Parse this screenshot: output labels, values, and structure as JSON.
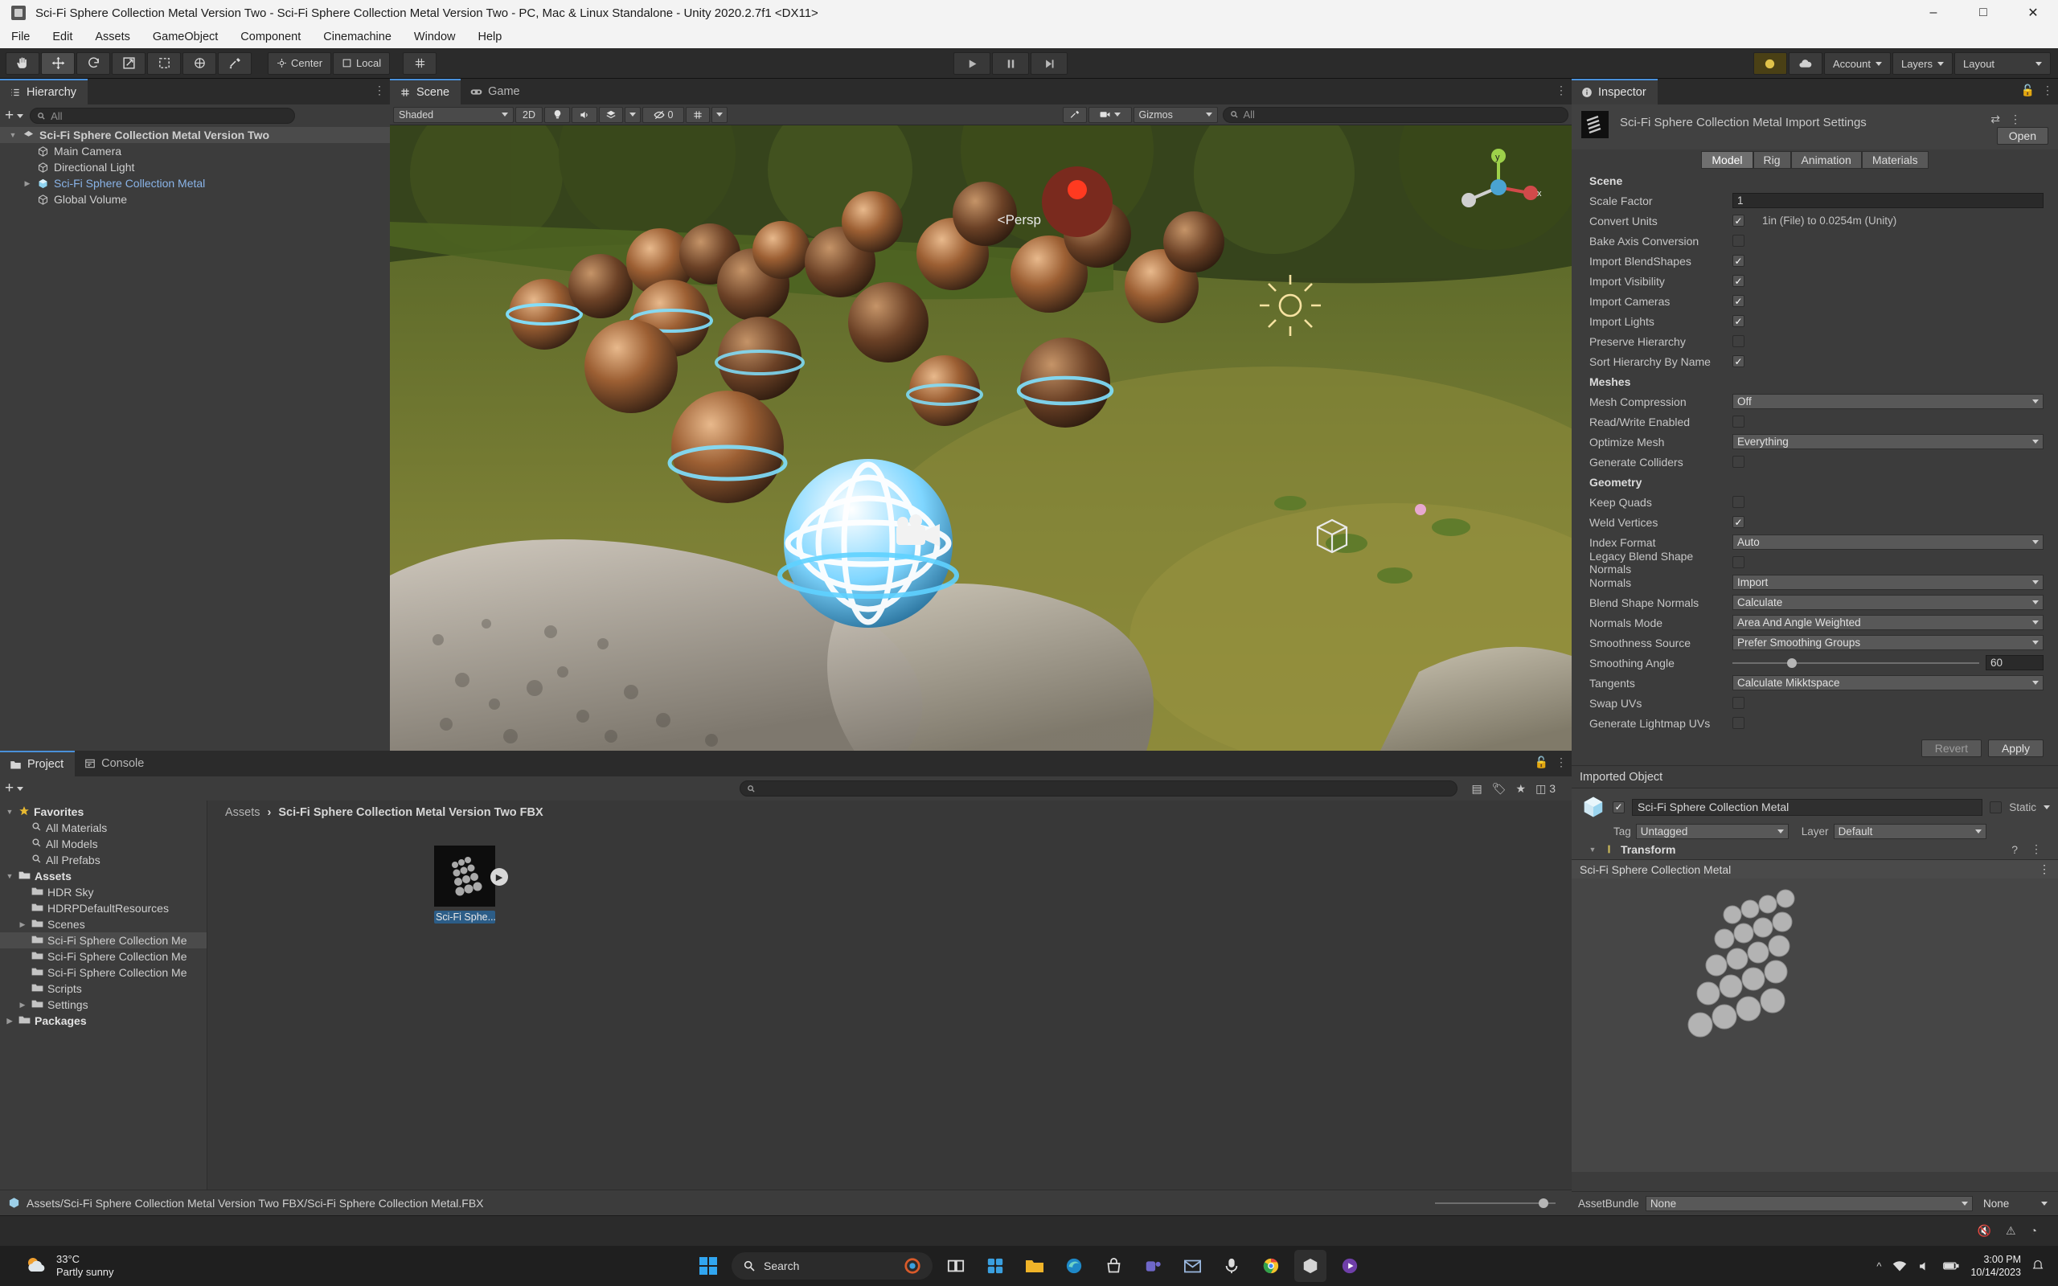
{
  "window": {
    "title": "Sci-Fi Sphere Collection Metal Version Two - Sci-Fi Sphere Collection Metal Version Two - PC, Mac & Linux Standalone - Unity 2020.2.7f1 <DX11>",
    "minimize": "–",
    "maximize": "□",
    "close": "✕"
  },
  "menubar": {
    "items": [
      "File",
      "Edit",
      "Assets",
      "GameObject",
      "Component",
      "Cinemachine",
      "Window",
      "Help"
    ]
  },
  "toolbar": {
    "tools": [
      "hand-tool",
      "move-tool",
      "rotate-tool",
      "scale-tool",
      "rect-tool",
      "transform-tool",
      "custom-tool"
    ],
    "pivot_label": "Center",
    "space_label": "Local",
    "play": "▶",
    "pause": "❙❙",
    "step": "▶|",
    "account_label": "Account",
    "layers_label": "Layers",
    "layout_label": "Layout"
  },
  "hierarchy": {
    "tab": "Hierarchy",
    "search_placeholder": "All",
    "items": [
      {
        "label": "Sci-Fi Sphere Collection Metal Version Two",
        "depth": 0,
        "twisty": "▼",
        "icon": "scene-icon",
        "style": "scene"
      },
      {
        "label": "Main Camera",
        "depth": 1,
        "twisty": "",
        "icon": "gameobject-icon",
        "style": "normal"
      },
      {
        "label": "Directional Light",
        "depth": 1,
        "twisty": "",
        "icon": "gameobject-icon",
        "style": "normal"
      },
      {
        "label": "Sci-Fi Sphere Collection Metal",
        "depth": 1,
        "twisty": "▶",
        "icon": "prefab-icon",
        "style": "prefab"
      },
      {
        "label": "Global Volume",
        "depth": 1,
        "twisty": "",
        "icon": "gameobject-icon",
        "style": "normal"
      }
    ]
  },
  "scene": {
    "tabs": [
      {
        "label": "Scene",
        "selected": true
      },
      {
        "label": "Game",
        "selected": false
      }
    ],
    "shading_mode": "Shaded",
    "mode_2d": "2D",
    "effects_count": "0",
    "gizmos_label": "Gizmos",
    "search_placeholder": "All",
    "persp_label": "Persp",
    "axis_labels": {
      "y": "y",
      "x": "x"
    }
  },
  "project": {
    "tabs": [
      {
        "label": "Project",
        "selected": true
      },
      {
        "label": "Console",
        "selected": false
      }
    ],
    "search_placeholder": "",
    "tree": [
      {
        "label": "Favorites",
        "depth": 0,
        "twisty": "▼",
        "icon": "star-icon",
        "bold": true
      },
      {
        "label": "All Materials",
        "depth": 1,
        "twisty": "",
        "icon": "search-icon",
        "bold": false
      },
      {
        "label": "All Models",
        "depth": 1,
        "twisty": "",
        "icon": "search-icon",
        "bold": false
      },
      {
        "label": "All Prefabs",
        "depth": 1,
        "twisty": "",
        "icon": "search-icon",
        "bold": false
      },
      {
        "label": "Assets",
        "depth": 0,
        "twisty": "▼",
        "icon": "folder-open-icon",
        "bold": true
      },
      {
        "label": "HDR Sky",
        "depth": 1,
        "twisty": "",
        "icon": "folder-icon",
        "bold": false
      },
      {
        "label": "HDRPDefaultResources",
        "depth": 1,
        "twisty": "",
        "icon": "folder-icon",
        "bold": false
      },
      {
        "label": "Scenes",
        "depth": 1,
        "twisty": "▶",
        "icon": "folder-icon",
        "bold": false
      },
      {
        "label": "Sci-Fi Sphere Collection Me",
        "depth": 1,
        "twisty": "",
        "icon": "folder-icon",
        "bold": false,
        "selected": true
      },
      {
        "label": "Sci-Fi Sphere Collection Me",
        "depth": 1,
        "twisty": "",
        "icon": "folder-icon",
        "bold": false
      },
      {
        "label": "Sci-Fi Sphere Collection Me",
        "depth": 1,
        "twisty": "",
        "icon": "folder-icon",
        "bold": false
      },
      {
        "label": "Scripts",
        "depth": 1,
        "twisty": "",
        "icon": "folder-icon",
        "bold": false
      },
      {
        "label": "Settings",
        "depth": 1,
        "twisty": "▶",
        "icon": "folder-icon",
        "bold": false
      },
      {
        "label": "Packages",
        "depth": 0,
        "twisty": "▶",
        "icon": "folder-icon",
        "bold": true
      }
    ],
    "breadcrumb": {
      "root": "Assets",
      "sep": "›",
      "current": "Sci-Fi Sphere Collection Metal Version Two FBX"
    },
    "asset": {
      "label": "Sci-Fi Sphe...",
      "play_badge": "▶"
    },
    "status_path": "Assets/Sci-Fi Sphere Collection Metal Version Two FBX/Sci-Fi Sphere Collection Metal.FBX"
  },
  "inspector": {
    "tab": "Inspector",
    "title": "Sci-Fi Sphere Collection Metal Import Settings",
    "open_button": "Open",
    "model_tabs": [
      {
        "label": "Model",
        "selected": true
      },
      {
        "label": "Rig",
        "selected": false
      },
      {
        "label": "Animation",
        "selected": false
      },
      {
        "label": "Materials",
        "selected": false
      }
    ],
    "sections": [
      {
        "type": "header",
        "label": "Scene"
      },
      {
        "type": "text",
        "label": "Scale Factor",
        "value": "1"
      },
      {
        "type": "check",
        "label": "Convert Units",
        "checked": true,
        "side": "1in (File) to 0.0254m (Unity)"
      },
      {
        "type": "check",
        "label": "Bake Axis Conversion",
        "checked": false,
        "side": ""
      },
      {
        "type": "check",
        "label": "Import BlendShapes",
        "checked": true,
        "side": ""
      },
      {
        "type": "check",
        "label": "Import Visibility",
        "checked": true,
        "side": ""
      },
      {
        "type": "check",
        "label": "Import Cameras",
        "checked": true,
        "side": ""
      },
      {
        "type": "check",
        "label": "Import Lights",
        "checked": true,
        "side": ""
      },
      {
        "type": "check",
        "label": "Preserve Hierarchy",
        "checked": false,
        "side": ""
      },
      {
        "type": "check",
        "label": "Sort Hierarchy By Name",
        "checked": true,
        "side": ""
      },
      {
        "type": "header",
        "label": "Meshes"
      },
      {
        "type": "dropdown",
        "label": "Mesh Compression",
        "value": "Off"
      },
      {
        "type": "check",
        "label": "Read/Write Enabled",
        "checked": false,
        "side": ""
      },
      {
        "type": "dropdown",
        "label": "Optimize Mesh",
        "value": "Everything"
      },
      {
        "type": "check",
        "label": "Generate Colliders",
        "checked": false,
        "side": ""
      },
      {
        "type": "header",
        "label": "Geometry"
      },
      {
        "type": "check",
        "label": "Keep Quads",
        "checked": false,
        "side": ""
      },
      {
        "type": "check",
        "label": "Weld Vertices",
        "checked": true,
        "side": ""
      },
      {
        "type": "dropdown",
        "label": "Index Format",
        "value": "Auto"
      },
      {
        "type": "check",
        "label": "Legacy Blend Shape Normals",
        "checked": false,
        "side": ""
      },
      {
        "type": "dropdown",
        "label": "Normals",
        "value": "Import"
      },
      {
        "type": "dropdown",
        "label": "Blend Shape Normals",
        "value": "Calculate"
      },
      {
        "type": "dropdown",
        "label": "Normals Mode",
        "value": "Area And Angle Weighted"
      },
      {
        "type": "dropdown",
        "label": "Smoothness Source",
        "value": "Prefer Smoothing Groups"
      },
      {
        "type": "slider",
        "label": "Smoothing Angle",
        "value": "60"
      },
      {
        "type": "dropdown",
        "label": "Tangents",
        "value": "Calculate Mikktspace"
      },
      {
        "type": "check",
        "label": "Swap UVs",
        "checked": false,
        "side": ""
      },
      {
        "type": "check",
        "label": "Generate Lightmap UVs",
        "checked": false,
        "side": ""
      }
    ],
    "revert_button": "Revert",
    "apply_button": "Apply",
    "imported_object_label": "Imported Object",
    "object": {
      "name": "Sci-Fi Sphere Collection Metal",
      "enabled": true,
      "static_label": "Static",
      "tag_label": "Tag",
      "tag_value": "Untagged",
      "layer_label": "Layer",
      "layer_value": "Default",
      "component_label": "Transform"
    },
    "preview_title": "Sci-Fi Sphere Collection Metal",
    "assetbundle_label": "AssetBundle",
    "assetbundle_value": "None",
    "assetbundle_variant": "None"
  },
  "taskbar": {
    "weather_temp": "33°C",
    "weather_desc": "Partly sunny",
    "search_placeholder": "Search",
    "time": "3:00 PM",
    "date": "10/14/2023",
    "icons": [
      "start-icon",
      "search-icon",
      "task-view-icon",
      "widgets-icon",
      "file-explorer-icon",
      "edge-icon",
      "store-icon",
      "teams-icon",
      "mail-icon",
      "voice-icon",
      "chrome-icon",
      "unity-icon",
      "media-icon"
    ]
  },
  "colors": {
    "accent": "#4a90d9",
    "select_blue": "#2c5d87",
    "panel": "#3c3c3c",
    "toolbar": "#2b2b2b"
  }
}
